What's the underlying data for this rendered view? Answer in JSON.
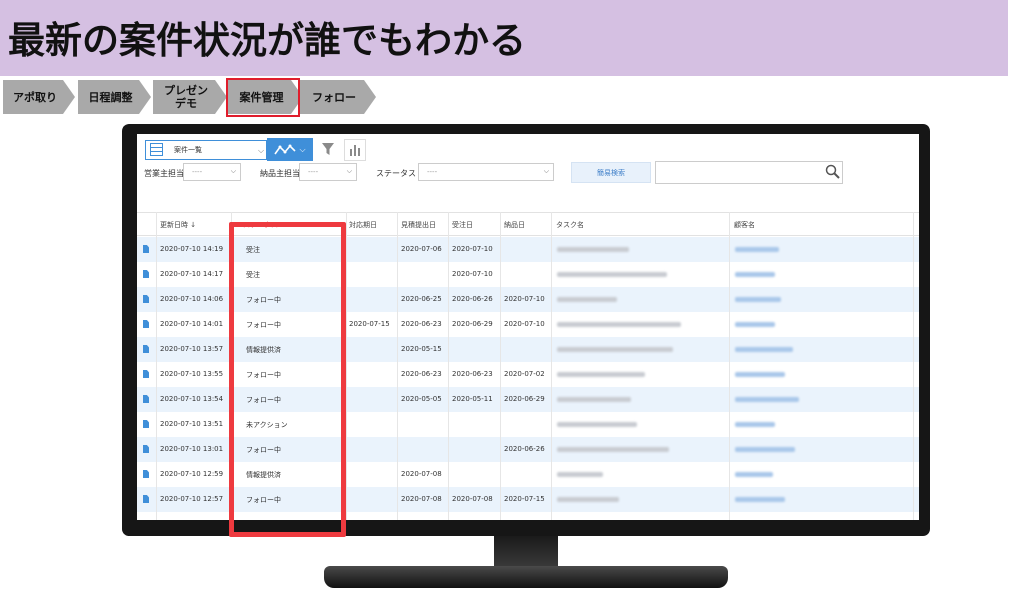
{
  "title": "最新の案件状況が誰でもわかる",
  "flow_steps": [
    {
      "label": "アポ取り"
    },
    {
      "label": "日程調整"
    },
    {
      "label": "プレゼン\nデモ"
    },
    {
      "label": "案件管理"
    },
    {
      "label": "フォロー"
    }
  ],
  "toolbar": {
    "view_select_value": "案件一覧",
    "graph_icon": "line-chart-icon",
    "filter_icon": "funnel-icon",
    "bar_icon": "bar-chart-icon"
  },
  "filters": {
    "sales_owner_label": "営業主担当",
    "sales_owner_value": "----",
    "delivery_owner_label": "納品主担当",
    "delivery_owner_value": "----",
    "status_label": "ステータス",
    "status_value": "----",
    "quick_search_label": "簡易検索",
    "search_icon": "magnifier-icon"
  },
  "table": {
    "columns": [
      "更新日時 ↓",
      "ステータス",
      "対応期日",
      "見積提出日",
      "受注日",
      "納品日",
      "タスク名",
      "顧客名"
    ],
    "rows": [
      {
        "updated": "2020-07-10 14:19",
        "status": "受注",
        "due": "",
        "quote": "2020-07-06",
        "order": "2020-07-10",
        "delivery": ""
      },
      {
        "updated": "2020-07-10 14:17",
        "status": "受注",
        "due": "",
        "quote": "",
        "order": "2020-07-10",
        "delivery": ""
      },
      {
        "updated": "2020-07-10 14:06",
        "status": "フォロー中",
        "due": "",
        "quote": "2020-06-25",
        "order": "2020-06-26",
        "delivery": "2020-07-10"
      },
      {
        "updated": "2020-07-10 14:01",
        "status": "フォロー中",
        "due": "2020-07-15",
        "quote": "2020-06-23",
        "order": "2020-06-29",
        "delivery": "2020-07-10"
      },
      {
        "updated": "2020-07-10 13:57",
        "status": "情報提供済",
        "due": "",
        "quote": "2020-05-15",
        "order": "",
        "delivery": ""
      },
      {
        "updated": "2020-07-10 13:55",
        "status": "フォロー中",
        "due": "",
        "quote": "2020-06-23",
        "order": "2020-06-23",
        "delivery": "2020-07-02"
      },
      {
        "updated": "2020-07-10 13:54",
        "status": "フォロー中",
        "due": "",
        "quote": "2020-05-05",
        "order": "2020-05-11",
        "delivery": "2020-06-29"
      },
      {
        "updated": "2020-07-10 13:51",
        "status": "未アクション",
        "due": "",
        "quote": "",
        "order": "",
        "delivery": ""
      },
      {
        "updated": "2020-07-10 13:01",
        "status": "フォロー中",
        "due": "",
        "quote": "",
        "order": "",
        "delivery": "2020-06-26"
      },
      {
        "updated": "2020-07-10 12:59",
        "status": "情報提供済",
        "due": "",
        "quote": "2020-07-08",
        "order": "",
        "delivery": ""
      },
      {
        "updated": "2020-07-10 12:57",
        "status": "フォロー中",
        "due": "",
        "quote": "2020-07-08",
        "order": "2020-07-08",
        "delivery": "2020-07-15"
      }
    ]
  },
  "colors": {
    "title_band": "#d5c0e2",
    "accent_blue": "#3f8fd9",
    "highlight_red": "#ee3a3f",
    "row_stripe": "#eaf3fc"
  }
}
